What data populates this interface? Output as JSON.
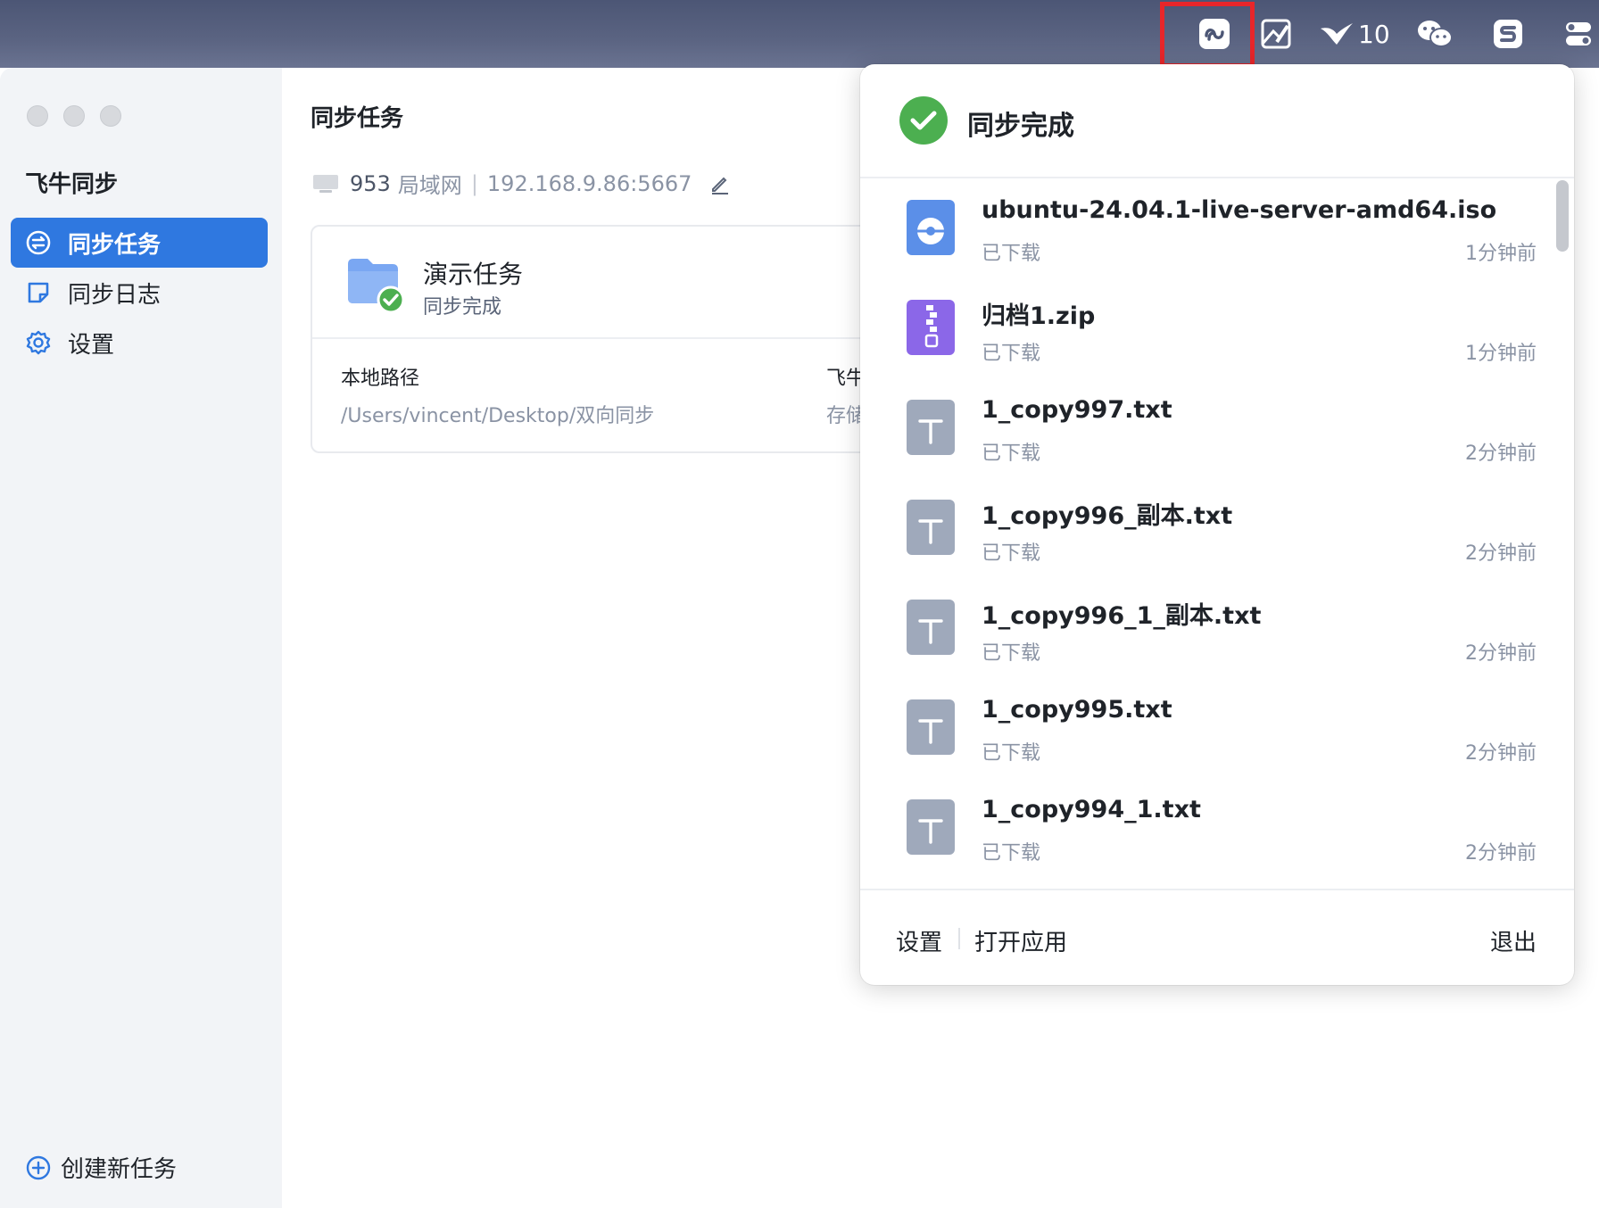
{
  "menubar": {
    "badge_count": "10",
    "icons": [
      "feiniu-sync-icon",
      "image-edit-icon",
      "bird-icon",
      "wechat-icon",
      "s-app-icon",
      "toggle-icon"
    ]
  },
  "sidebar": {
    "app_title": "飞牛同步",
    "items": [
      {
        "label": "同步任务",
        "icon": "sync-icon",
        "active": true
      },
      {
        "label": "同步日志",
        "icon": "log-icon",
        "active": false
      },
      {
        "label": "设置",
        "icon": "gear-icon",
        "active": false
      }
    ],
    "create_task": "创建新任务"
  },
  "main": {
    "page_title": "同步任务",
    "server": {
      "name": "953",
      "network": "局域网",
      "address": "192.168.9.86:5667"
    },
    "task": {
      "name": "演示任务",
      "status": "同步完成",
      "local_path_label": "本地路径",
      "local_path": "/Users/vincent/Desktop/双向同步",
      "remote_label": "飞牛",
      "remote_value": "存储"
    }
  },
  "popover": {
    "title": "同步完成",
    "files": [
      {
        "name": "ubuntu-24.04.1-live-server-amd64.iso",
        "status": "已下载",
        "time": "1分钟前",
        "type": "iso"
      },
      {
        "name": "归档1.zip",
        "status": "已下载",
        "time": "1分钟前",
        "type": "zip"
      },
      {
        "name": "1_copy997.txt",
        "status": "已下载",
        "time": "2分钟前",
        "type": "txt"
      },
      {
        "name": "1_copy996_副本.txt",
        "status": "已下载",
        "time": "2分钟前",
        "type": "txt"
      },
      {
        "name": "1_copy996_1_副本.txt",
        "status": "已下载",
        "time": "2分钟前",
        "type": "txt"
      },
      {
        "name": "1_copy995.txt",
        "status": "已下载",
        "time": "2分钟前",
        "type": "txt"
      },
      {
        "name": "1_copy994_1.txt",
        "status": "已下载",
        "time": "2分钟前",
        "type": "txt"
      }
    ],
    "footer": {
      "settings": "设置",
      "open_app": "打开应用",
      "quit": "退出"
    }
  },
  "colors": {
    "accent": "#2f78e0",
    "success": "#4caf50",
    "highlight": "#e8262a"
  }
}
